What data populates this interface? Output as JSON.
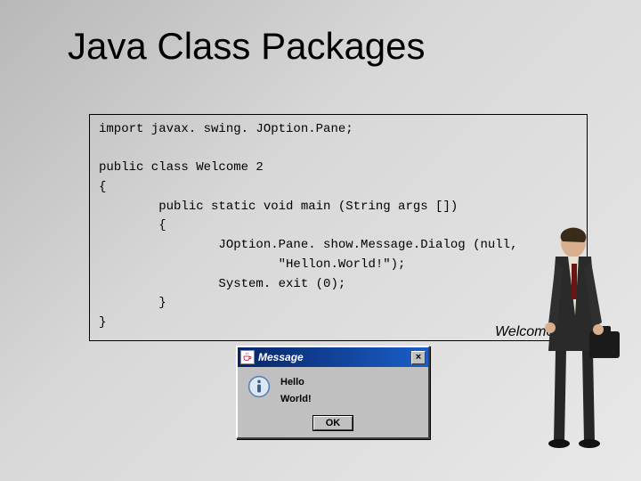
{
  "title": "Java Class Packages",
  "code": "import javax. swing. JOption.Pane;\n\npublic class Welcome 2\n{\n        public static void main (String args [])\n        {\n                JOption.Pane. show.Message.Dialog (null,\n                        \"Hellon.World!\");\n                System. exit (0);\n        }\n}",
  "caption": "Welcome 2.java",
  "dialog": {
    "title": "Message",
    "line1": "Hello",
    "line2": "World!",
    "ok": "OK",
    "close": "×"
  }
}
